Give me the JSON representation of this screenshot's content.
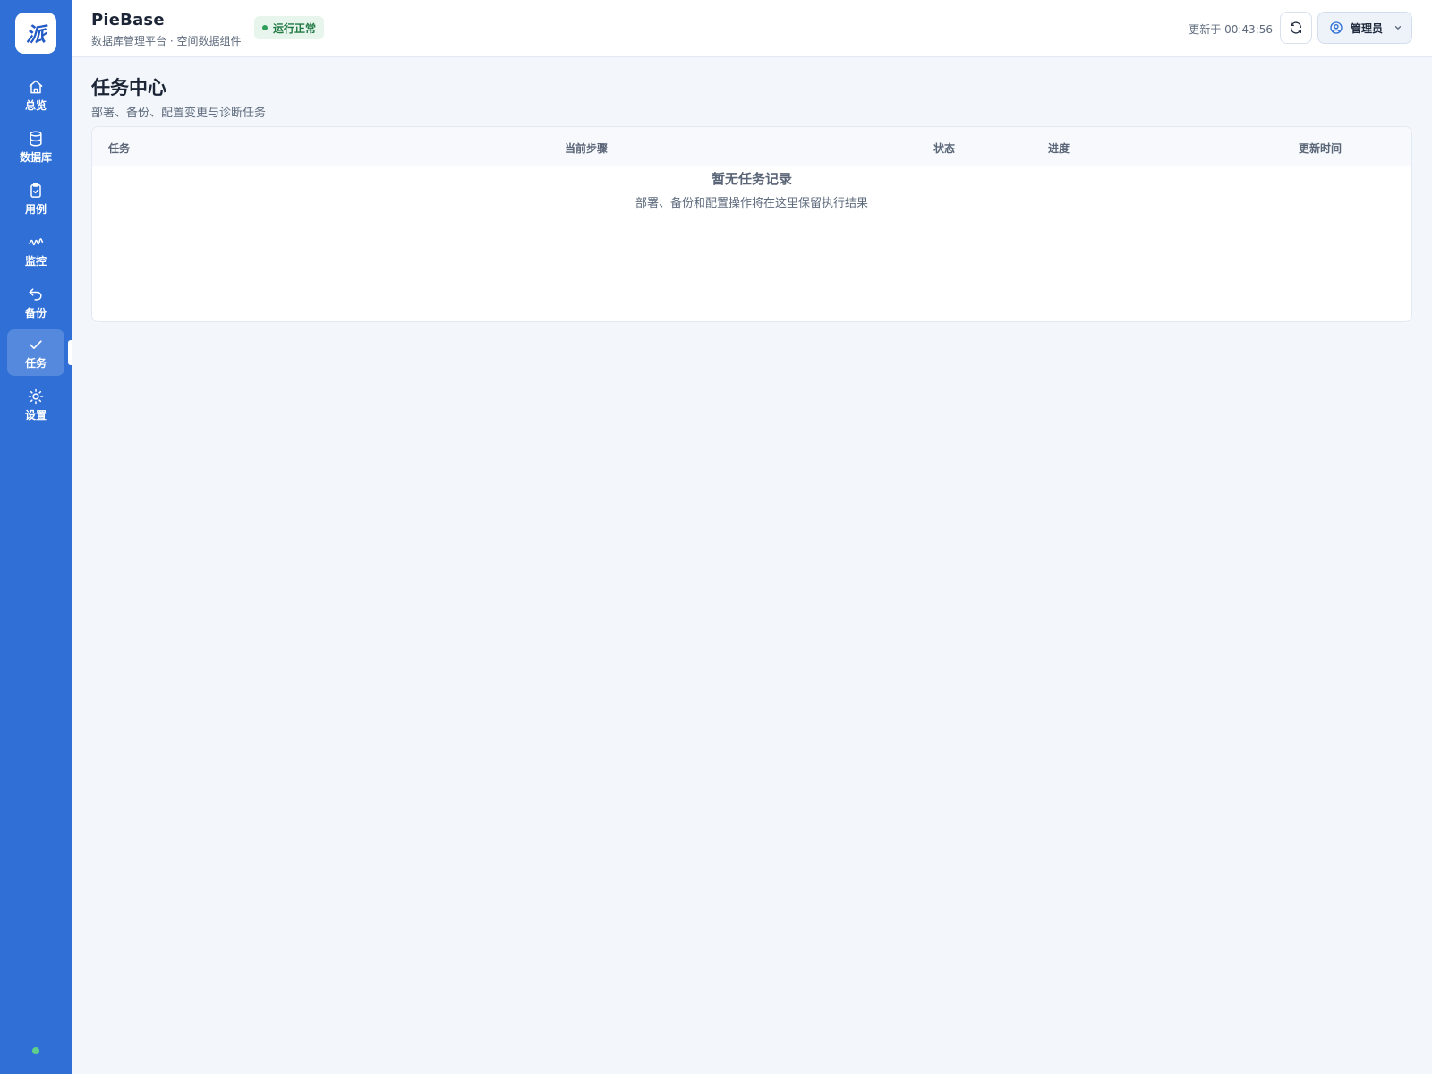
{
  "sidebar": {
    "logo_text": "派",
    "items": [
      {
        "label": "总览",
        "icon": "home-icon"
      },
      {
        "label": "数据库",
        "icon": "database-icon"
      },
      {
        "label": "用例",
        "icon": "clipboard-icon"
      },
      {
        "label": "监控",
        "icon": "activity-icon"
      },
      {
        "label": "备份",
        "icon": "undo-icon"
      },
      {
        "label": "任务",
        "icon": "check-icon"
      },
      {
        "label": "设置",
        "icon": "sun-icon"
      }
    ],
    "active_item": "任务"
  },
  "header": {
    "title": "PieBase",
    "subtitle": "数据库管理平台 · 空间数据组件",
    "status_badge": "运行正常",
    "updated": "更新于 00:43:56",
    "user": "管理员"
  },
  "main": {
    "title": "任务中心",
    "subtitle": "部署、备份、配置变更与诊断任务",
    "table": {
      "columns": [
        "任务",
        "当前步骤",
        "状态",
        "进度",
        "更新时间"
      ],
      "empty_title": "暂无任务记录",
      "empty_subtitle": "部署、备份和配置操作将在这里保留执行结果"
    }
  },
  "colors": {
    "sidebar": "#2f6fd6",
    "background": "#f3f7fb",
    "status_ok": "#2f9e5a"
  }
}
